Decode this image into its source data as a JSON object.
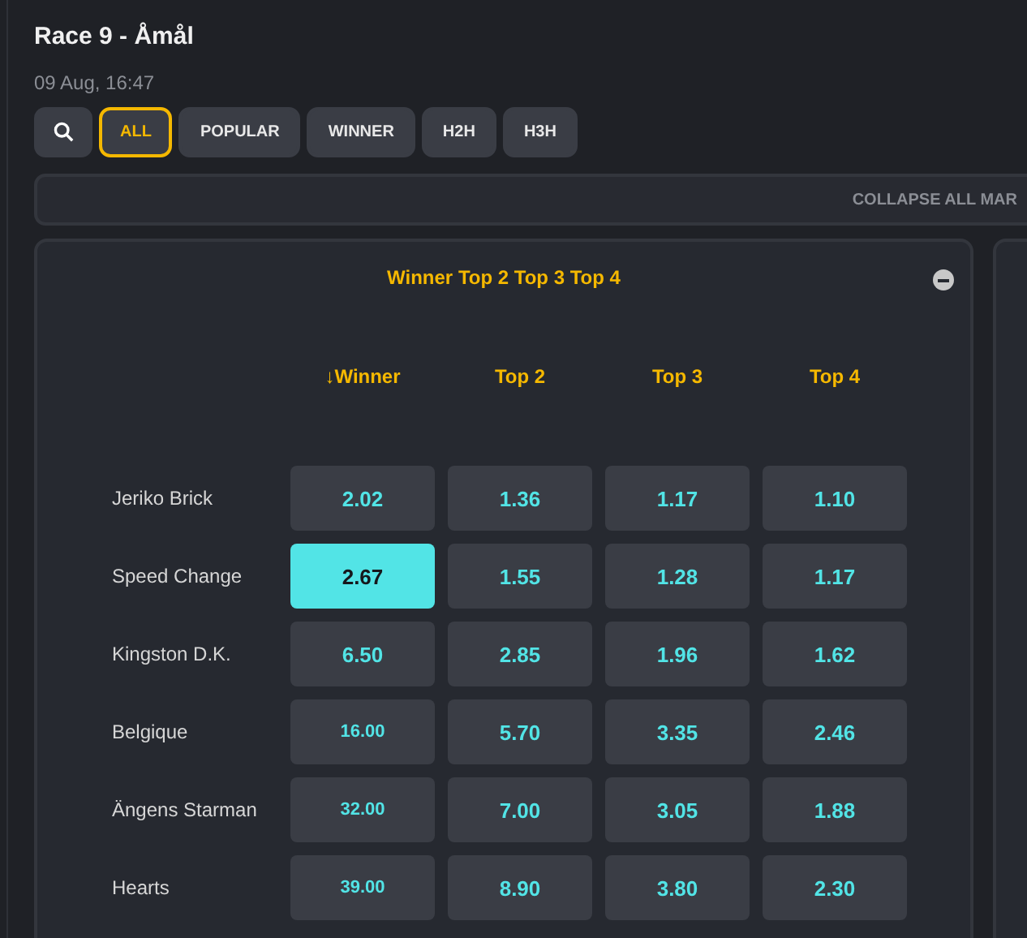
{
  "header": {
    "title": "Race 9 - Åmål",
    "date": "09 Aug, 16:47"
  },
  "filters": [
    {
      "label": "ALL",
      "selected": true
    },
    {
      "label": "POPULAR",
      "selected": false
    },
    {
      "label": "WINNER",
      "selected": false
    },
    {
      "label": "H2H",
      "selected": false
    },
    {
      "label": "H3H",
      "selected": false
    }
  ],
  "collapse_all": "COLLAPSE ALL MAR",
  "market": {
    "title": "Winner Top 2 Top 3 Top 4",
    "expanded": true,
    "columns": [
      {
        "label": "↓Winner"
      },
      {
        "label": "Top 2"
      },
      {
        "label": "Top 3"
      },
      {
        "label": "Top 4"
      }
    ],
    "rows": [
      {
        "name": "Jeriko Brick",
        "odds": [
          {
            "value": "2.02",
            "selected": false
          },
          {
            "value": "1.36",
            "selected": false
          },
          {
            "value": "1.17",
            "selected": false
          },
          {
            "value": "1.10",
            "selected": false
          }
        ]
      },
      {
        "name": "Speed Change",
        "odds": [
          {
            "value": "2.67",
            "selected": true
          },
          {
            "value": "1.55",
            "selected": false
          },
          {
            "value": "1.28",
            "selected": false
          },
          {
            "value": "1.17",
            "selected": false
          }
        ]
      },
      {
        "name": "Kingston D.K.",
        "odds": [
          {
            "value": "6.50",
            "selected": false
          },
          {
            "value": "2.85",
            "selected": false
          },
          {
            "value": "1.96",
            "selected": false
          },
          {
            "value": "1.62",
            "selected": false
          }
        ]
      },
      {
        "name": "Belgique",
        "odds": [
          {
            "value": "16.00",
            "selected": false
          },
          {
            "value": "5.70",
            "selected": false
          },
          {
            "value": "3.35",
            "selected": false
          },
          {
            "value": "2.46",
            "selected": false
          }
        ]
      },
      {
        "name": "Ängens Starman",
        "odds": [
          {
            "value": "32.00",
            "selected": false
          },
          {
            "value": "7.00",
            "selected": false
          },
          {
            "value": "3.05",
            "selected": false
          },
          {
            "value": "1.88",
            "selected": false
          }
        ]
      },
      {
        "name": "Hearts",
        "odds": [
          {
            "value": "39.00",
            "selected": false
          },
          {
            "value": "8.90",
            "selected": false
          },
          {
            "value": "3.80",
            "selected": false
          },
          {
            "value": "2.30",
            "selected": false
          }
        ]
      }
    ]
  }
}
